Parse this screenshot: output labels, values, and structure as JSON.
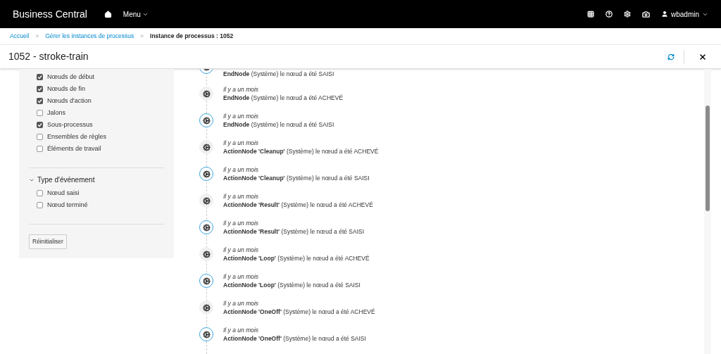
{
  "navbar": {
    "brand": "Business Central",
    "menu": "Menu",
    "user": "wbadmin"
  },
  "breadcrumb": [
    {
      "label": "Accueil",
      "link": true
    },
    {
      "separator": "»",
      "label": "Gérer les instances de processus",
      "link": true
    },
    {
      "separator": "»",
      "label": "Instance de processus : 1052",
      "link": false
    }
  ],
  "title": "1052 - stroke-train",
  "filters": {
    "node_types": [
      {
        "label": "Nœuds de début",
        "checked": true
      },
      {
        "label": "Nœuds de fin",
        "checked": true
      },
      {
        "label": "Nœuds d'action",
        "checked": true
      },
      {
        "label": "Jalons",
        "checked": false
      },
      {
        "label": "Sous-processus",
        "checked": true
      },
      {
        "label": "Ensembles de règles",
        "checked": false
      },
      {
        "label": "Éléments de travail",
        "checked": false
      }
    ],
    "event_type": {
      "title": "Type d'événement",
      "expanded": true,
      "options": [
        {
          "label": "Nœud saisi",
          "checked": false
        },
        {
          "label": "Nœud terminé",
          "checked": false
        }
      ]
    },
    "reset": "Réinitialiser"
  },
  "events": [
    {
      "kind": "entered",
      "text": "**EndNode** (Système) le nœud a été SAISI"
    },
    {
      "kind": "completed",
      "time": "Il y a un mois",
      "text": "**EndNode** (Système) le nœud a été ACHEVÉ"
    },
    {
      "kind": "entered",
      "time": "Il y a un mois",
      "text": "**EndNode** (Système) le nœud a été SAISI"
    },
    {
      "kind": "completed",
      "time": "Il y a un mois",
      "text": "**ActionNode 'Cleanup'** (Système) le nœud a été ACHEVÉ"
    },
    {
      "kind": "entered",
      "time": "Il y a un mois",
      "text": "**ActionNode 'Cleanup'** (Système) le nœud a été SAISI"
    },
    {
      "kind": "completed",
      "time": "Il y a un mois",
      "text": "**ActionNode 'Result'** (Système) le nœud a été ACHEVÉ"
    },
    {
      "kind": "entered",
      "time": "Il y a un mois",
      "text": "**ActionNode 'Result'** (Système) le nœud a été SAISI"
    },
    {
      "kind": "completed",
      "time": "Il y a un mois",
      "text": "**ActionNode 'Loop'** (Système) le nœud a été ACHEVÉ"
    },
    {
      "kind": "entered",
      "time": "Il y a un mois",
      "text": "**ActionNode 'Loop'** (Système) le nœud a été SAISI"
    },
    {
      "kind": "completed",
      "time": "Il y a un mois",
      "text": "**ActionNode 'OneOff'** (Système) le nœud a été ACHEVÉ"
    },
    {
      "kind": "entered",
      "time": "Il y a un mois",
      "text": "**ActionNode 'OneOff'** (Système) le nœud a été SAISI"
    }
  ]
}
